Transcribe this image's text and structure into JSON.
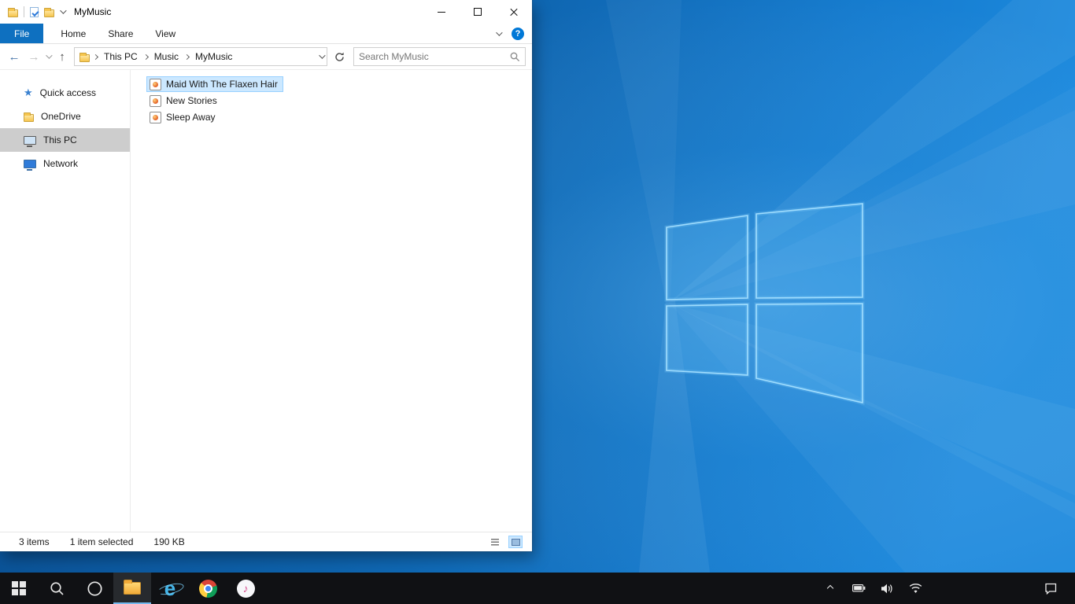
{
  "window": {
    "title": "MyMusic",
    "ribbon": {
      "tabs": [
        {
          "label": "File",
          "active": true
        },
        {
          "label": "Home",
          "active": false
        },
        {
          "label": "Share",
          "active": false
        },
        {
          "label": "View",
          "active": false
        }
      ]
    },
    "nav": {
      "breadcrumb": [
        "This PC",
        "Music",
        "MyMusic"
      ],
      "search_placeholder": "Search MyMusic"
    },
    "sidebar": {
      "items": [
        {
          "label": "Quick access",
          "selected": false
        },
        {
          "label": "OneDrive",
          "selected": false
        },
        {
          "label": "This PC",
          "selected": true
        },
        {
          "label": "Network",
          "selected": false
        }
      ]
    },
    "files": [
      {
        "name": "Maid With The Flaxen Hair",
        "selected": true
      },
      {
        "name": "New Stories",
        "selected": false
      },
      {
        "name": "Sleep Away",
        "selected": false
      }
    ],
    "statusbar": {
      "items_count": "3 items",
      "selection": "1 item selected",
      "selection_size": "190 KB"
    }
  },
  "taskbar": {
    "buttons": [
      "start",
      "search",
      "cortana",
      "file-explorer",
      "internet-explorer",
      "chrome",
      "itunes"
    ],
    "active_button": "file-explorer",
    "tray": [
      "show-hidden-icons",
      "battery",
      "speaker",
      "network",
      "action-center"
    ]
  },
  "icons": {
    "back": "arrow-left",
    "forward": "arrow-right",
    "up": "arrow-up",
    "refresh": "refresh",
    "search": "magnifier",
    "help": "question-mark",
    "quick_access": "star",
    "onedrive": "folder",
    "this_pc": "monitor",
    "network": "network-monitor",
    "media_file": "audio-file",
    "start": "windows-logo",
    "cortana": "circle-ring",
    "file_explorer": "folder",
    "internet_explorer": "letter-e",
    "chrome": "chrome-circle",
    "itunes": "music-note"
  },
  "colors": {
    "accent": "#0078d7",
    "file_tab": "#0e70c0",
    "selection_bg": "#cce8ff",
    "selection_border": "#99d1ff",
    "sidebar_selected": "#cdcdcd",
    "taskbar_bg": "#101114",
    "taskbar_active": "#76b9ed"
  }
}
